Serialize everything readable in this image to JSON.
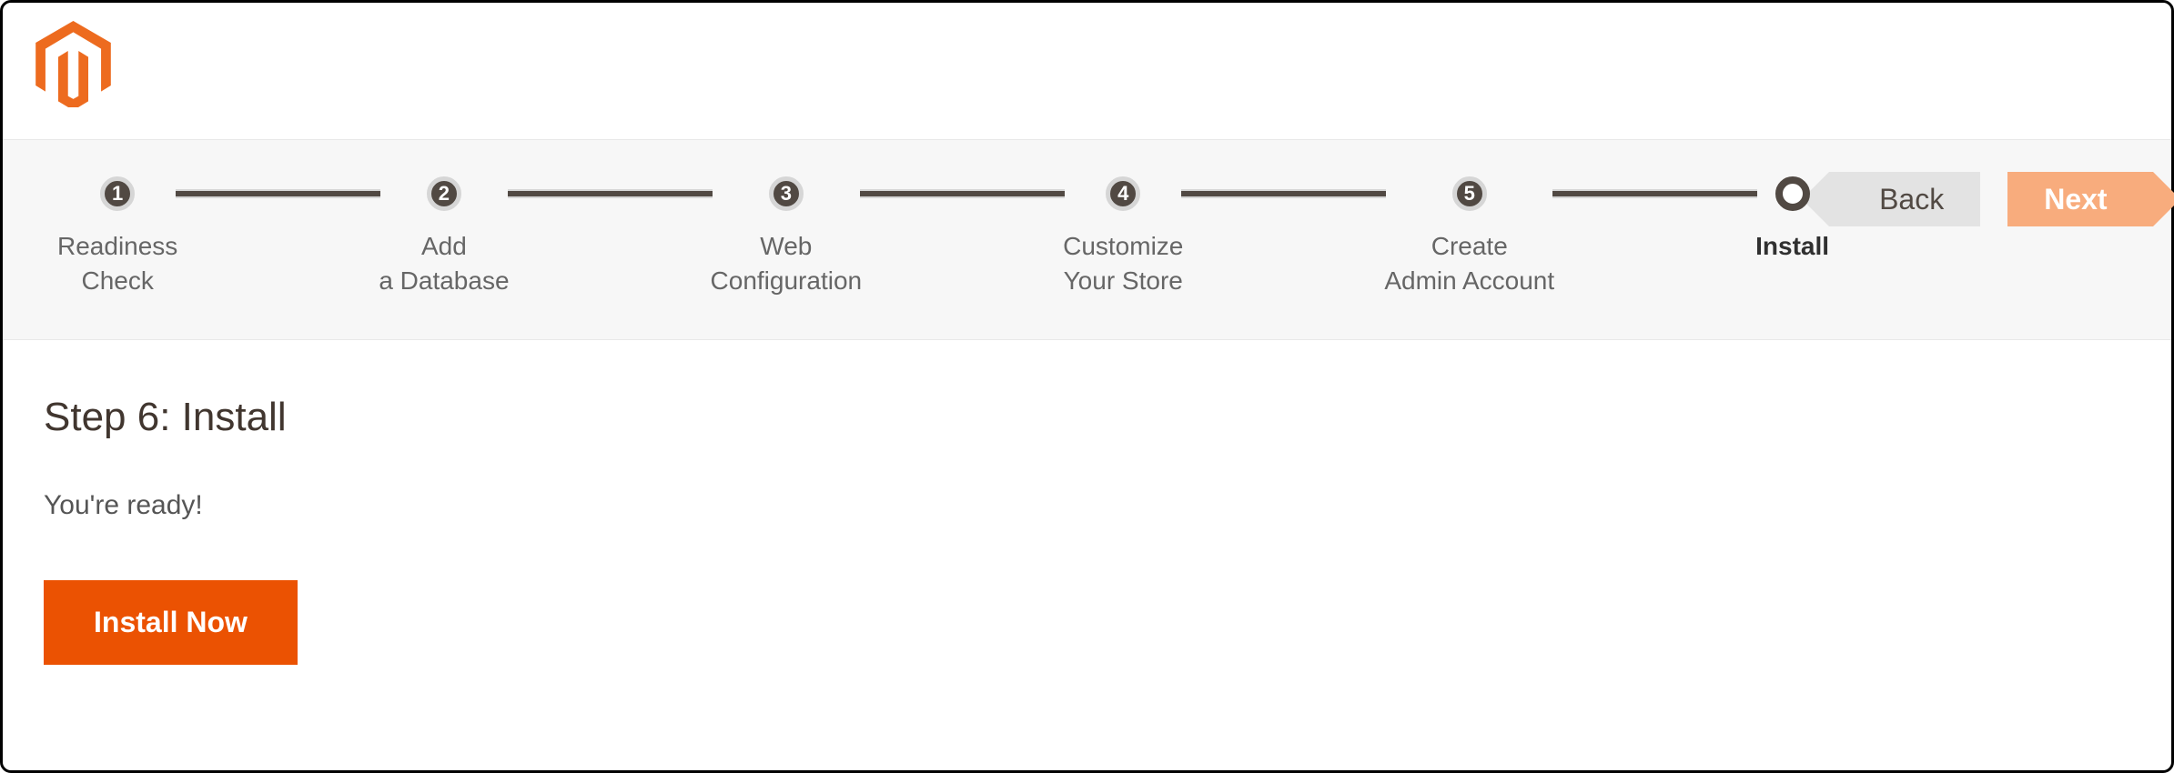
{
  "steps": [
    {
      "num": "1",
      "label": "Readiness\nCheck"
    },
    {
      "num": "2",
      "label": "Add\na Database"
    },
    {
      "num": "3",
      "label": "Web\nConfiguration"
    },
    {
      "num": "4",
      "label": "Customize\nYour Store"
    },
    {
      "num": "5",
      "label": "Create\nAdmin Account"
    },
    {
      "num": "",
      "label": "Install",
      "active": true
    }
  ],
  "nav": {
    "back": "Back",
    "next": "Next"
  },
  "page": {
    "title": "Step 6: Install",
    "ready_text": "You're ready!",
    "install_button": "Install Now"
  }
}
